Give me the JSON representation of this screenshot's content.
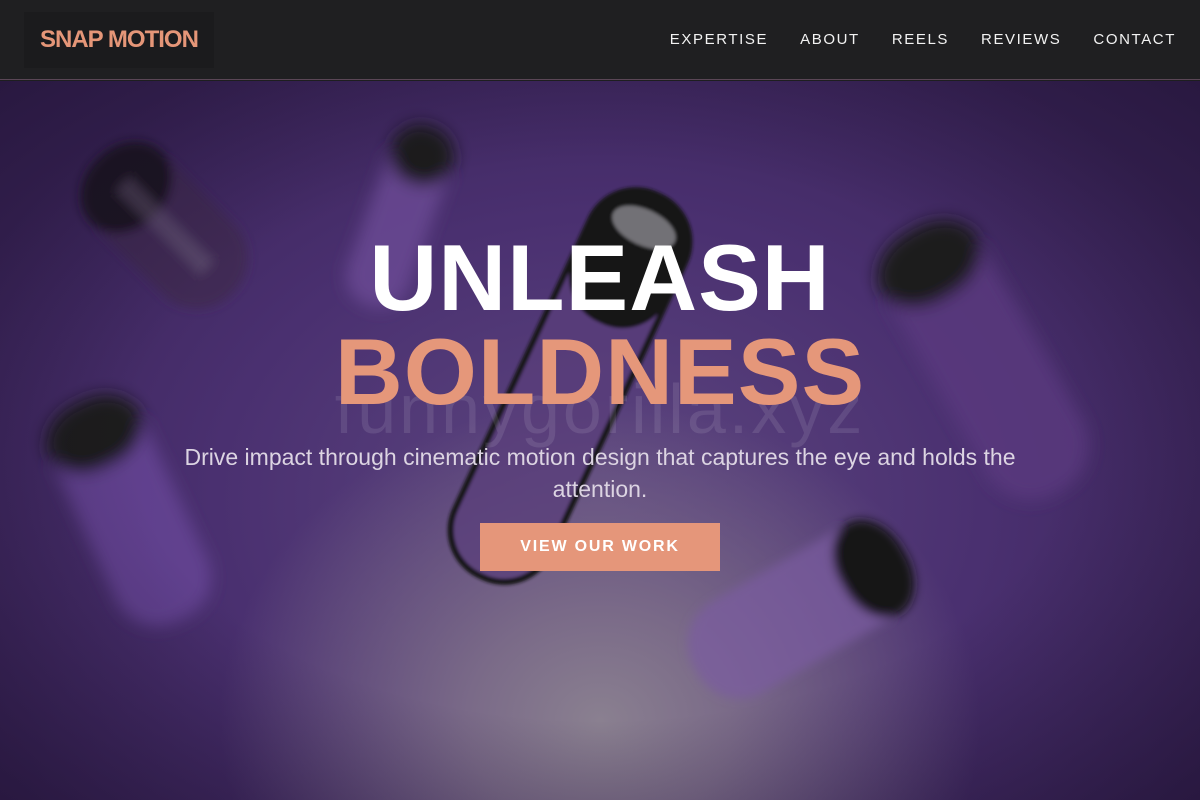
{
  "brand": {
    "logo_text": "SNAP MOTION",
    "accent_color": "#e5967a"
  },
  "nav": {
    "items": [
      {
        "label": "EXPERTISE"
      },
      {
        "label": "ABOUT"
      },
      {
        "label": "REELS"
      },
      {
        "label": "REVIEWS"
      },
      {
        "label": "CONTACT"
      }
    ]
  },
  "hero": {
    "title_line_1": "UNLEASH",
    "title_line_2": "BOLDNESS",
    "subtitle": "Drive impact through cinematic motion design that captures the eye and holds the attention.",
    "cta_label": "VIEW OUR WORK",
    "watermark_text": "funnygorilla.xyz",
    "background_description": "blurred-floating-capsules",
    "colors": {
      "background_purple": "#4a3070",
      "title_primary": "#ffffff",
      "title_accent": "#e5977a"
    }
  }
}
